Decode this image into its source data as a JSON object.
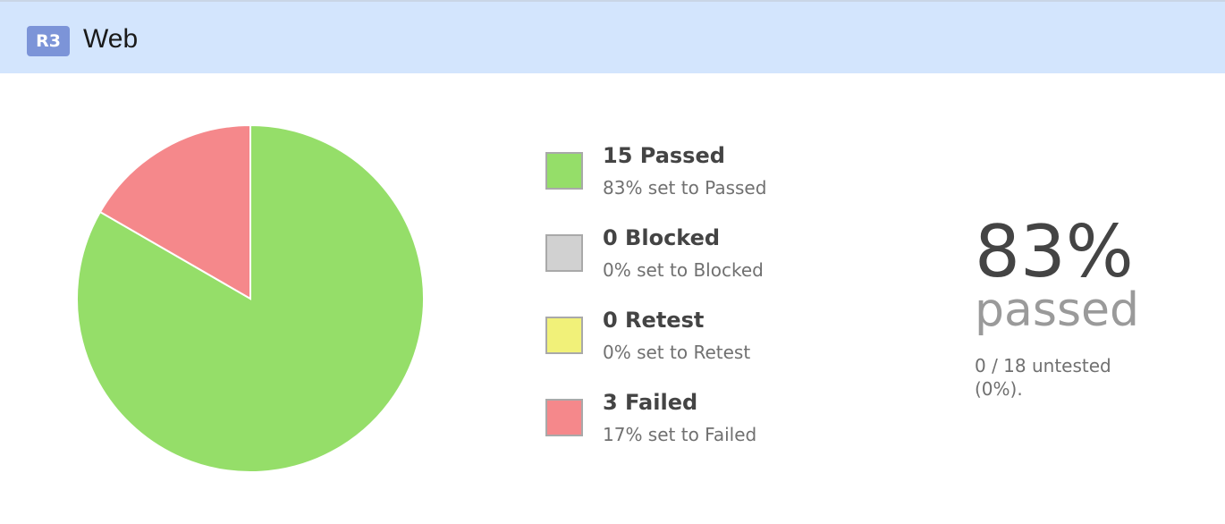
{
  "header": {
    "badge": "R3",
    "title": "Web"
  },
  "chart_data": {
    "type": "pie",
    "slices": [
      {
        "label": "Passed",
        "value": 15,
        "color": "#95de69"
      },
      {
        "label": "Blocked",
        "value": 0,
        "color": "#d1d1d1"
      },
      {
        "label": "Retest",
        "value": 0,
        "color": "#f1f179"
      },
      {
        "label": "Failed",
        "value": 3,
        "color": "#f5888b"
      }
    ],
    "total": 18
  },
  "legend": [
    {
      "title": "15 Passed",
      "sub": "83% set to Passed",
      "color": "#95de69"
    },
    {
      "title": "0 Blocked",
      "sub": "0% set to Blocked",
      "color": "#d1d1d1"
    },
    {
      "title": "0 Retest",
      "sub": "0% set to Retest",
      "color": "#f1f179"
    },
    {
      "title": "3 Failed",
      "sub": "17% set to Failed",
      "color": "#f5888b"
    }
  ],
  "summary": {
    "percent": "83%",
    "label": "passed",
    "untested": "0 / 18 untested (0%)."
  }
}
